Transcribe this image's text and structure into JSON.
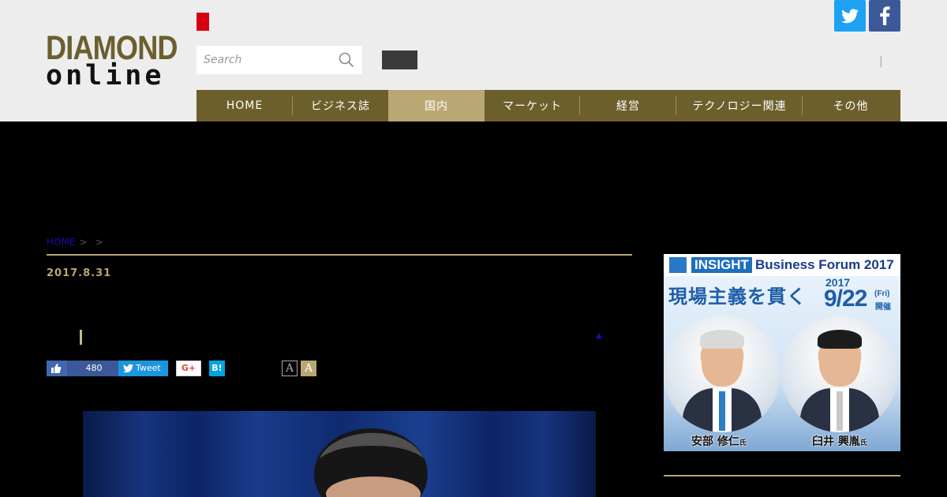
{
  "header": {
    "logo_line1": "DIAMOND",
    "logo_line2": "online",
    "search_placeholder": "Search",
    "pipe": "|"
  },
  "nav": {
    "items": [
      {
        "label": "HOME"
      },
      {
        "label": "ビジネス誌"
      },
      {
        "label": "国内"
      },
      {
        "label": "マーケット"
      },
      {
        "label": "経営"
      },
      {
        "label": "テクノロジー関連"
      },
      {
        "label": "その他"
      }
    ],
    "active_index": 2
  },
  "breadcrumb": {
    "home": "HOME",
    "sep1": ">",
    "sep2": ">"
  },
  "article": {
    "date": "2017.8.31",
    "toggle": "▲"
  },
  "share": {
    "like_count": "480",
    "tweet": "Tweet",
    "gplus": "G+",
    "hatena": "B!",
    "font_small": "A",
    "font_large": "A"
  },
  "ad": {
    "insight": "INSIGHT",
    "business_forum": "Business Forum 2017",
    "catch": "現場主義を貫く",
    "year": "2017",
    "date": "9/22",
    "weekday": "(Fri)",
    "held": "開催",
    "speaker1_name": "安部 修仁",
    "speaker2_name": "臼井 興胤",
    "honorific": "氏"
  },
  "colors": {
    "header_bg": "#ededed",
    "nav_bg": "#6d5f2b",
    "nav_active": "#b9a774",
    "gold": "#b9a774",
    "twitter": "#1da1f2",
    "facebook": "#3b5998"
  }
}
